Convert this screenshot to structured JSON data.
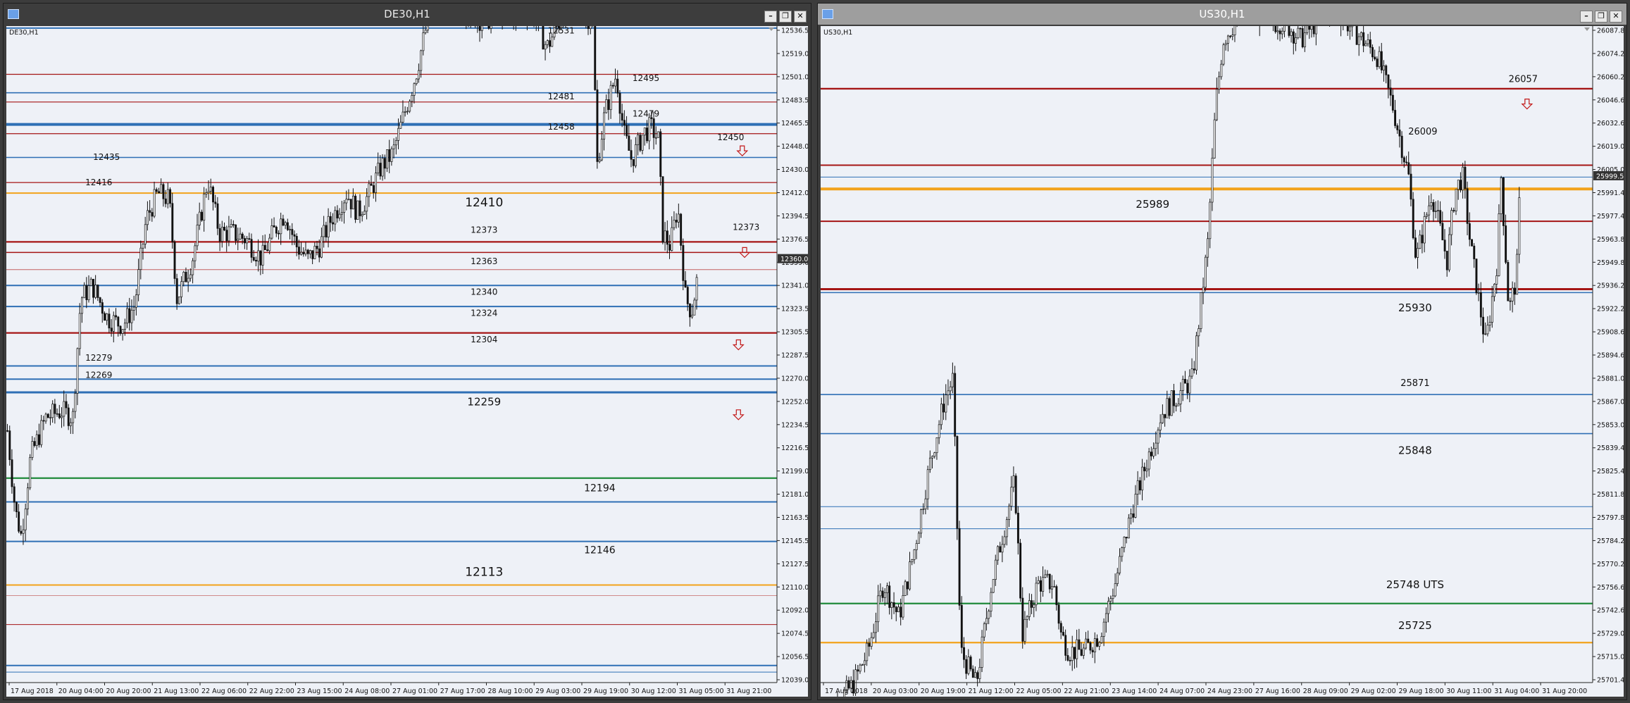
{
  "windows": [
    {
      "id": "de",
      "title": "DE30,H1",
      "symbol_label": "DE30,H1",
      "current_price": "12360.05",
      "current": 12360.05,
      "ylim": [
        12039.05,
        12536.55
      ],
      "price_ticks": [
        "12536.55",
        "12519.05",
        "12501.05",
        "12483.55",
        "12465.55",
        "12448.05",
        "12430.05",
        "12412.05",
        "12394.55",
        "12376.55",
        "12359.05",
        "12341.05",
        "12323.55",
        "12305.55",
        "12287.55",
        "12270.05",
        "12252.05",
        "12234.55",
        "12216.55",
        "12199.05",
        "12181.05",
        "12163.55",
        "12145.55",
        "12127.55",
        "12110.05",
        "12092.05",
        "12074.55",
        "12056.55",
        "12039.05"
      ],
      "time_labels": [
        "17 Aug 2018",
        "20 Aug 04:00",
        "20 Aug 20:00",
        "21 Aug 13:00",
        "22 Aug 06:00",
        "22 Aug 22:00",
        "23 Aug 15:00",
        "24 Aug 08:00",
        "27 Aug 01:00",
        "27 Aug 17:00",
        "28 Aug 10:00",
        "29 Aug 03:00",
        "29 Aug 19:00",
        "30 Aug 12:00",
        "31 Aug 05:00",
        "31 Aug 21:00"
      ],
      "hlines": [
        {
          "price": 12535,
          "color": "#2e6fb5",
          "width": 2
        },
        {
          "price": 12500,
          "color": "#a51515",
          "width": 1.2
        },
        {
          "price": 12486,
          "color": "#2e6fb5",
          "width": 1.6
        },
        {
          "price": 12479,
          "color": "#a51515",
          "width": 1.2
        },
        {
          "price": 12462,
          "color": "#2e6fb5",
          "width": 4
        },
        {
          "price": 12455,
          "color": "#a51515",
          "width": 1.2
        },
        {
          "price": 12437,
          "color": "#2e6fb5",
          "width": 1.6
        },
        {
          "price": 12418,
          "color": "#a51515",
          "width": 1.2
        },
        {
          "price": 12410,
          "color": "#f2a21b",
          "width": 2
        },
        {
          "price": 12373,
          "color": "#a51515",
          "width": 2.2
        },
        {
          "price": 12365,
          "color": "#a51515",
          "width": 1.6
        },
        {
          "price": 12352,
          "color": "#c46060",
          "width": 1
        },
        {
          "price": 12340,
          "color": "#2e6fb5",
          "width": 2
        },
        {
          "price": 12324,
          "color": "#2e6fb5",
          "width": 2
        },
        {
          "price": 12304,
          "color": "#a51515",
          "width": 2.2
        },
        {
          "price": 12279,
          "color": "#2e6fb5",
          "width": 2
        },
        {
          "price": 12269,
          "color": "#2e6fb5",
          "width": 2
        },
        {
          "price": 12259,
          "color": "#2e6fb5",
          "width": 3
        },
        {
          "price": 12194,
          "color": "#1f8a3a",
          "width": 2.2
        },
        {
          "price": 12176,
          "color": "#2e6fb5",
          "width": 2
        },
        {
          "price": 12146,
          "color": "#2e6fb5",
          "width": 2
        },
        {
          "price": 12113,
          "color": "#f2a21b",
          "width": 2
        },
        {
          "price": 12105,
          "color": "#d08a8a",
          "width": 1
        },
        {
          "price": 12083,
          "color": "#a51515",
          "width": 1
        },
        {
          "price": 12052,
          "color": "#2e6fb5",
          "width": 2
        },
        {
          "price": 12047,
          "color": "#2e6fb5",
          "width": 1
        }
      ],
      "labels": [
        {
          "text": "12531",
          "t": 0.72,
          "price": 12531,
          "size": 12
        },
        {
          "text": "12495",
          "t": 0.83,
          "price": 12495,
          "size": 12
        },
        {
          "text": "12481",
          "t": 0.72,
          "price": 12481,
          "size": 12
        },
        {
          "text": "12479",
          "t": 0.83,
          "price": 12468,
          "size": 12
        },
        {
          "text": "12458",
          "t": 0.72,
          "price": 12458,
          "size": 12
        },
        {
          "text": "12450",
          "t": 0.94,
          "price": 12450,
          "size": 12
        },
        {
          "text": "12435",
          "t": 0.13,
          "price": 12435,
          "size": 12
        },
        {
          "text": "12416",
          "t": 0.12,
          "price": 12416,
          "size": 12
        },
        {
          "text": "12410",
          "t": 0.62,
          "price": 12400,
          "size": 17
        },
        {
          "text": "12373",
          "t": 0.62,
          "price": 12380,
          "size": 12
        },
        {
          "text": "12373",
          "t": 0.96,
          "price": 12382,
          "size": 12
        },
        {
          "text": "12363",
          "t": 0.62,
          "price": 12356,
          "size": 12
        },
        {
          "text": "12340",
          "t": 0.62,
          "price": 12333,
          "size": 12
        },
        {
          "text": "12324",
          "t": 0.62,
          "price": 12317,
          "size": 12
        },
        {
          "text": "12304",
          "t": 0.62,
          "price": 12297,
          "size": 12
        },
        {
          "text": "12279",
          "t": 0.12,
          "price": 12283,
          "size": 12
        },
        {
          "text": "12269",
          "t": 0.12,
          "price": 12270,
          "size": 12
        },
        {
          "text": "12259",
          "t": 0.62,
          "price": 12249,
          "size": 15
        },
        {
          "text": "12194",
          "t": 0.77,
          "price": 12184,
          "size": 14
        },
        {
          "text": "12146",
          "t": 0.77,
          "price": 12137,
          "size": 14
        },
        {
          "text": "12113",
          "t": 0.62,
          "price": 12120,
          "size": 17
        }
      ],
      "arrows": [
        {
          "t": 0.955,
          "price": 12442
        },
        {
          "t": 0.958,
          "price": 12365
        },
        {
          "t": 0.95,
          "price": 12295
        },
        {
          "t": 0.95,
          "price": 12242
        }
      ],
      "path": [
        [
          0,
          12230
        ],
        [
          0.01,
          12170
        ],
        [
          0.018,
          12150
        ],
        [
          0.03,
          12210
        ],
        [
          0.05,
          12240
        ],
        [
          0.07,
          12245
        ],
        [
          0.085,
          12240
        ],
        [
          0.095,
          12330
        ],
        [
          0.11,
          12340
        ],
        [
          0.13,
          12315
        ],
        [
          0.15,
          12310
        ],
        [
          0.165,
          12325
        ],
        [
          0.18,
          12390
        ],
        [
          0.195,
          12410
        ],
        [
          0.21,
          12405
        ],
        [
          0.22,
          12330
        ],
        [
          0.24,
          12360
        ],
        [
          0.26,
          12420
        ],
        [
          0.275,
          12380
        ],
        [
          0.29,
          12380
        ],
        [
          0.31,
          12375
        ],
        [
          0.33,
          12360
        ],
        [
          0.345,
          12380
        ],
        [
          0.36,
          12395
        ],
        [
          0.375,
          12370
        ],
        [
          0.39,
          12360
        ],
        [
          0.405,
          12370
        ],
        [
          0.42,
          12390
        ],
        [
          0.44,
          12410
        ],
        [
          0.455,
          12395
        ],
        [
          0.47,
          12410
        ],
        [
          0.485,
          12430
        ],
        [
          0.5,
          12440
        ],
        [
          0.515,
          12470
        ],
        [
          0.53,
          12500
        ],
        [
          0.545,
          12540
        ],
        [
          0.56,
          12560
        ],
        [
          0.58,
          12560
        ],
        [
          0.6,
          12545
        ],
        [
          0.62,
          12540
        ],
        [
          0.64,
          12550
        ],
        [
          0.66,
          12545
        ],
        [
          0.68,
          12550
        ],
        [
          0.7,
          12520
        ],
        [
          0.72,
          12545
        ],
        [
          0.74,
          12550
        ],
        [
          0.76,
          12540
        ],
        [
          0.765,
          12430
        ],
        [
          0.775,
          12470
        ],
        [
          0.79,
          12500
        ],
        [
          0.8,
          12455
        ],
        [
          0.81,
          12435
        ],
        [
          0.825,
          12455
        ],
        [
          0.835,
          12460
        ],
        [
          0.845,
          12450
        ],
        [
          0.85,
          12380
        ],
        [
          0.86,
          12370
        ],
        [
          0.87,
          12400
        ],
        [
          0.875,
          12365
        ],
        [
          0.88,
          12330
        ],
        [
          0.888,
          12320
        ],
        [
          0.895,
          12345
        ]
      ]
    },
    {
      "id": "us",
      "title": "US30,H1",
      "symbol_label": "US30,H1",
      "current_price": "25999.58",
      "current": 25999.58,
      "ylim": [
        25701.47,
        26087.87
      ],
      "price_ticks": [
        "26087.87",
        "26074.27",
        "26060.27",
        "26046.67",
        "26032.67",
        "26019.07",
        "26005.07",
        "25991.47",
        "25977.47",
        "25963.87",
        "25949.87",
        "25936.27",
        "25922.27",
        "25908.67",
        "25894.67",
        "25881.07",
        "25867.07",
        "25853.07",
        "25839.47",
        "25825.47",
        "25811.87",
        "25797.87",
        "25784.27",
        "25770.27",
        "25756.67",
        "25742.67",
        "25729.07",
        "25715.07",
        "25701.47"
      ],
      "time_labels": [
        "17 Aug 2018",
        "20 Aug 03:00",
        "20 Aug 19:00",
        "21 Aug 12:00",
        "22 Aug 05:00",
        "22 Aug 21:00",
        "23 Aug 14:00",
        "24 Aug 07:00",
        "24 Aug 23:00",
        "27 Aug 16:00",
        "28 Aug 09:00",
        "29 Aug 02:00",
        "29 Aug 18:00",
        "30 Aug 11:00",
        "31 Aug 04:00",
        "31 Aug 20:00"
      ],
      "hlines": [
        {
          "price": 26051,
          "color": "#a51515",
          "width": 2.4
        },
        {
          "price": 26006,
          "color": "#a51515",
          "width": 2
        },
        {
          "price": 25999,
          "color": "#2e6fb5",
          "width": 1
        },
        {
          "price": 25992,
          "color": "#f2a21b",
          "width": 4
        },
        {
          "price": 25973,
          "color": "#a51515",
          "width": 2
        },
        {
          "price": 25933,
          "color": "#a51515",
          "width": 3
        },
        {
          "price": 25931,
          "color": "#2e6fb5",
          "width": 1.6
        },
        {
          "price": 25871,
          "color": "#2e6fb5",
          "width": 1.6
        },
        {
          "price": 25848,
          "color": "#2e6fb5",
          "width": 1.6
        },
        {
          "price": 25805,
          "color": "#2e6fb5",
          "width": 1
        },
        {
          "price": 25792,
          "color": "#2e6fb5",
          "width": 1
        },
        {
          "price": 25748,
          "color": "#1f8a3a",
          "width": 2.2
        },
        {
          "price": 25725,
          "color": "#f2a21b",
          "width": 2.2
        }
      ],
      "labels": [
        {
          "text": "26057",
          "t": 0.91,
          "price": 26055,
          "size": 13
        },
        {
          "text": "26009",
          "t": 0.78,
          "price": 26024,
          "size": 13
        },
        {
          "text": "25989",
          "t": 0.43,
          "price": 25981,
          "size": 15
        },
        {
          "text": "25930",
          "t": 0.77,
          "price": 25920,
          "size": 15
        },
        {
          "text": "25871",
          "t": 0.77,
          "price": 25876,
          "size": 13
        },
        {
          "text": "25848",
          "t": 0.77,
          "price": 25836,
          "size": 15
        },
        {
          "text": "25748 UTS",
          "t": 0.77,
          "price": 25757,
          "size": 15
        },
        {
          "text": "25725",
          "t": 0.77,
          "price": 25733,
          "size": 15
        }
      ],
      "arrows": [
        {
          "t": 0.915,
          "price": 26042
        }
      ],
      "path": [
        [
          0,
          25680
        ],
        [
          0.02,
          25690
        ],
        [
          0.04,
          25700
        ],
        [
          0.06,
          25720
        ],
        [
          0.08,
          25760
        ],
        [
          0.1,
          25740
        ],
        [
          0.12,
          25780
        ],
        [
          0.14,
          25830
        ],
        [
          0.16,
          25870
        ],
        [
          0.17,
          25880
        ],
        [
          0.18,
          25720
        ],
        [
          0.2,
          25700
        ],
        [
          0.22,
          25760
        ],
        [
          0.25,
          25820
        ],
        [
          0.26,
          25730
        ],
        [
          0.28,
          25760
        ],
        [
          0.3,
          25760
        ],
        [
          0.31,
          25730
        ],
        [
          0.32,
          25720
        ],
        [
          0.34,
          25720
        ],
        [
          0.36,
          25730
        ],
        [
          0.38,
          25760
        ],
        [
          0.4,
          25800
        ],
        [
          0.42,
          25830
        ],
        [
          0.44,
          25860
        ],
        [
          0.46,
          25870
        ],
        [
          0.48,
          25880
        ],
        [
          0.5,
          25960
        ],
        [
          0.51,
          26040
        ],
        [
          0.52,
          26080
        ],
        [
          0.55,
          26100
        ],
        [
          0.58,
          26090
        ],
        [
          0.6,
          26090
        ],
        [
          0.62,
          26080
        ],
        [
          0.64,
          26090
        ],
        [
          0.66,
          26100
        ],
        [
          0.68,
          26090
        ],
        [
          0.7,
          26080
        ],
        [
          0.72,
          26070
        ],
        [
          0.74,
          26040
        ],
        [
          0.76,
          26000
        ],
        [
          0.77,
          25950
        ],
        [
          0.79,
          25990
        ],
        [
          0.8,
          25970
        ],
        [
          0.81,
          25950
        ],
        [
          0.82,
          25990
        ],
        [
          0.83,
          26000
        ],
        [
          0.84,
          25960
        ],
        [
          0.85,
          25930
        ],
        [
          0.86,
          25900
        ],
        [
          0.875,
          25950
        ],
        [
          0.88,
          26000
        ],
        [
          0.89,
          25920
        ],
        [
          0.9,
          25940
        ],
        [
          0.905,
          26000
        ]
      ]
    }
  ]
}
